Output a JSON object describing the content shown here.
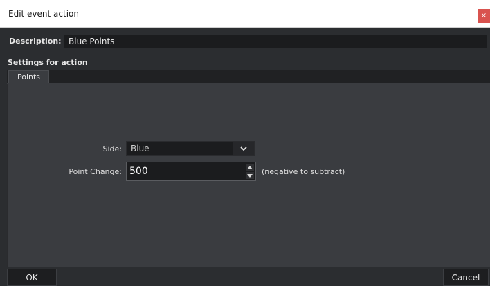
{
  "window": {
    "title": "Edit event action",
    "close_glyph": "×"
  },
  "description": {
    "label": "Description:",
    "value": "Blue Points"
  },
  "settings": {
    "label": "Settings for action",
    "tabs": [
      {
        "label": "Points"
      }
    ]
  },
  "form": {
    "side": {
      "label": "Side:",
      "value": "Blue"
    },
    "point_change": {
      "label": "Point Change:",
      "value": "500",
      "hint": "(negative to subtract)"
    }
  },
  "buttons": {
    "ok": "OK",
    "cancel": "Cancel"
  },
  "colors": {
    "close_button": "#d9534f",
    "background": "#2b2d30",
    "panel": "#3a3c40",
    "input": "#1b1c1e"
  },
  "icons": {
    "close": "close-icon",
    "dropdown": "chevron-down-icon",
    "spin_up": "spin-up-icon",
    "spin_down": "spin-down-icon"
  }
}
